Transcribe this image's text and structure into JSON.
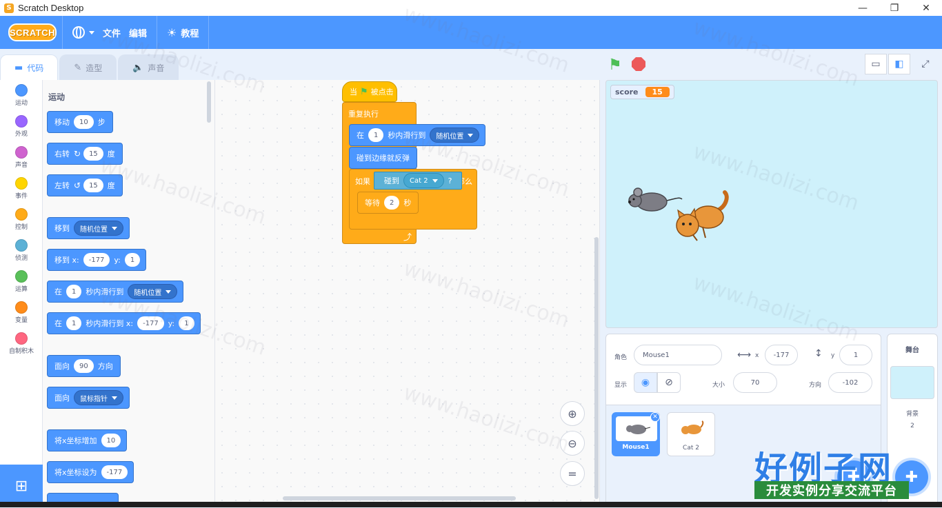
{
  "window": {
    "title": "Scratch Desktop",
    "minimize": "—",
    "maximize": "❐",
    "close": "✕"
  },
  "menubar": {
    "logo": "SCRATCH",
    "file": "文件",
    "edit": "编辑",
    "tutorials": "教程"
  },
  "tabs": [
    {
      "label": "代码",
      "icon": "code-icon"
    },
    {
      "label": "造型",
      "icon": "brush-icon"
    },
    {
      "label": "声音",
      "icon": "speaker-icon"
    }
  ],
  "categories": [
    {
      "label": "运动",
      "color": "#4c97ff"
    },
    {
      "label": "外观",
      "color": "#9966ff"
    },
    {
      "label": "声音",
      "color": "#cf63cf"
    },
    {
      "label": "事件",
      "color": "#ffd500"
    },
    {
      "label": "控制",
      "color": "#ffab19"
    },
    {
      "label": "侦测",
      "color": "#5cb1d6"
    },
    {
      "label": "运算",
      "color": "#59c059"
    },
    {
      "label": "变量",
      "color": "#ff8c1a"
    },
    {
      "label": "自制积木",
      "color": "#ff6680"
    }
  ],
  "palette": {
    "section": "运动",
    "move": {
      "a": "移动",
      "v": "10",
      "b": "步"
    },
    "turn_right": {
      "a": "右转",
      "v": "15",
      "b": "度"
    },
    "turn_left": {
      "a": "左转",
      "v": "15",
      "b": "度"
    },
    "goto": {
      "a": "移到",
      "d": "随机位置"
    },
    "goto_xy": {
      "a": "移到 x:",
      "x": "-177",
      "b": "y:",
      "y": "1"
    },
    "glide": {
      "a": "在",
      "v": "1",
      "b": "秒内滑行到",
      "d": "随机位置"
    },
    "glide_xy": {
      "a": "在",
      "v": "1",
      "b": "秒内滑行到 x:",
      "x": "-177",
      "c": "y:",
      "y": "1"
    },
    "point": {
      "a": "面向",
      "v": "90",
      "b": "方向"
    },
    "point_towards": {
      "a": "面向",
      "d": "鼠标指针"
    },
    "change_x": {
      "a": "将x坐标增加",
      "v": "10"
    },
    "set_x": {
      "a": "将x坐标设为",
      "v": "-177"
    }
  },
  "script": {
    "hat": {
      "a": "当",
      "b": "被点击"
    },
    "forever": "重复执行",
    "glide": {
      "a": "在",
      "v": "1",
      "b": "秒内滑行到",
      "d": "随机位置"
    },
    "bounce": "碰到边缘就反弹",
    "if": {
      "a": "如果",
      "then": "那么"
    },
    "touching": {
      "a": "碰到",
      "d": "Cat 2",
      "q": "?"
    },
    "wait": {
      "a": "等待",
      "v": "2",
      "b": "秒"
    }
  },
  "stage": {
    "monitor_label": "score",
    "monitor_value": "15"
  },
  "sprite_info": {
    "sprite_label": "角色",
    "sprite_name": "Mouse1",
    "x_label": "x",
    "x": "-177",
    "y_label": "y",
    "y": "1",
    "show_label": "显示",
    "size_label": "大小",
    "size": "70",
    "direction_label": "方向",
    "direction": "-102"
  },
  "sprites": [
    {
      "name": "Mouse1"
    },
    {
      "name": "Cat 2"
    }
  ],
  "stage_pane": {
    "title": "舞台",
    "backdrops_label": "背景",
    "backdrops_count": "2"
  },
  "watermark": {
    "line": "www.haolizi.com",
    "big": "好例子网",
    "small": "开发实例分享交流平台"
  }
}
